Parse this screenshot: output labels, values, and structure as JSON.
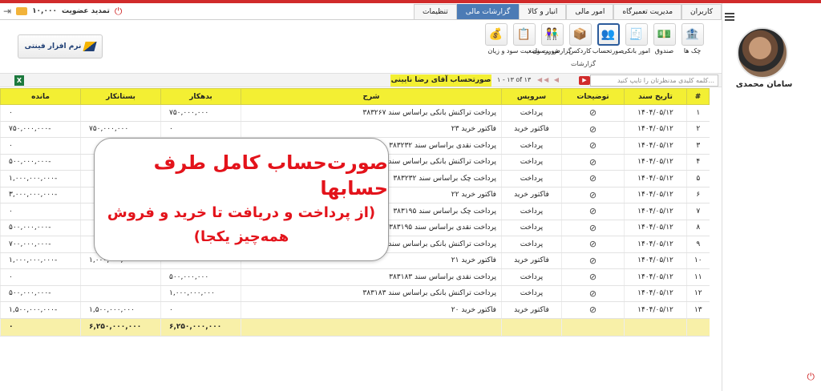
{
  "header": {
    "balance": "۱۰,۰۰۰",
    "renew_label": "تمدید عضویت"
  },
  "tabs": [
    {
      "label": "کاربران",
      "active": false
    },
    {
      "label": "مدیریت تعمیرگاه",
      "active": false
    },
    {
      "label": "امور مالی",
      "active": false
    },
    {
      "label": "انبار و کالا",
      "active": false
    },
    {
      "label": "گزارشات مالی",
      "active": true
    },
    {
      "label": "تنظیمات",
      "active": false
    }
  ],
  "logo_text": "نرم افزار فینتی",
  "tools": [
    {
      "label": "چک ها",
      "icon": "cheques-icon",
      "glyph": "🏦",
      "active": false
    },
    {
      "label": "صندوق",
      "icon": "cashbox-icon",
      "glyph": "💵",
      "active": false
    },
    {
      "label": "امور بانکی",
      "icon": "bank-affairs-icon",
      "glyph": "🧾",
      "active": false
    },
    {
      "label": "صورتحساب",
      "icon": "statement-icon",
      "glyph": "👥",
      "active": true
    },
    {
      "label": "کاردکس",
      "icon": "cardex-icon",
      "glyph": "📦",
      "active": false
    },
    {
      "label": "گزارش پرسنل",
      "icon": "personnel-report-icon",
      "glyph": "👫",
      "active": false
    },
    {
      "label": "صورت وضعیت سود و زیان",
      "icon": "profit-loss-icon",
      "glyph": "📋",
      "active": false
    },
    {
      "label": "",
      "icon": "statement-report-icon",
      "glyph": "💰",
      "active": false
    }
  ],
  "tools_group_label": "گزارشات",
  "filter": {
    "search_placeholder": "کلمه کلیدی مدنظرتان را تایپ کنید...",
    "page_info": "۱ - ۱۳ of ۱۳",
    "account_label": "صورتحساب آقای رضا نایینی"
  },
  "table": {
    "headers": [
      "#",
      "تاریخ سند",
      "توضیحات",
      "سرویس",
      "شرح",
      "بدهکار",
      "بستانکار",
      "مانده"
    ],
    "rows": [
      {
        "n": "۱",
        "date": "۱۴۰۴/۰۵/۱۲",
        "service": "پرداخت",
        "desc": "پرداخت تراکنش بانکی براساس سند ۳۸۳۲۶۷",
        "debit": "۷۵۰,۰۰۰,۰۰۰",
        "credit": "",
        "balance": "۰"
      },
      {
        "n": "۲",
        "date": "۱۴۰۴/۰۵/۱۲",
        "service": "فاکتور خرید",
        "desc": "فاکتور خرید ۲۳",
        "debit": "۰",
        "credit": "۷۵۰,۰۰۰,۰۰۰",
        "balance": "-۷۵۰,۰۰۰,۰۰۰"
      },
      {
        "n": "۳",
        "date": "۱۴۰۴/۰۵/۱۲",
        "service": "پرداخت",
        "desc": "پرداخت نقدی براساس سند ۳۸۳۲۳۲",
        "debit": "",
        "credit": "",
        "balance": "۰"
      },
      {
        "n": "۴",
        "date": "۱۴۰۴/۰۵/۱۲",
        "service": "پرداخت",
        "desc": "پرداخت تراکنش بانکی براساس سند ۳۸۳۲۳۲",
        "debit": "",
        "credit": "",
        "balance": "-۵۰۰,۰۰۰,۰۰۰"
      },
      {
        "n": "۵",
        "date": "۱۴۰۴/۰۵/۱۲",
        "service": "پرداخت",
        "desc": "پرداخت چک براساس سند ۳۸۳۲۳۲",
        "debit": "",
        "credit": "",
        "balance": "-۱,۰۰۰,۰۰۰,۰۰۰"
      },
      {
        "n": "۶",
        "date": "۱۴۰۴/۰۵/۱۲",
        "service": "فاکتور خرید",
        "desc": "فاکتور خرید ۲۲",
        "debit": "",
        "credit": "",
        "balance": "-۳,۰۰۰,۰۰۰,۰۰۰"
      },
      {
        "n": "۷",
        "date": "۱۴۰۴/۰۵/۱۲",
        "service": "پرداخت",
        "desc": "پرداخت چک براساس سند ۳۸۳۱۹۵",
        "debit": "",
        "credit": "",
        "balance": "۰"
      },
      {
        "n": "۸",
        "date": "۱۴۰۴/۰۵/۱۲",
        "service": "پرداخت",
        "desc": "پرداخت نقدی براساس سند ۳۸۳۱۹۵",
        "debit": "",
        "credit": "",
        "balance": "-۵۰۰,۰۰۰,۰۰۰"
      },
      {
        "n": "۹",
        "date": "۱۴۰۴/۰۵/۱۲",
        "service": "پرداخت",
        "desc": "پرداخت تراکنش بانکی براساس سند ۳۸۳۱۹۵",
        "debit": "",
        "credit": "",
        "balance": "-۷۰۰,۰۰۰,۰۰۰"
      },
      {
        "n": "۱۰",
        "date": "۱۴۰۴/۰۵/۱۲",
        "service": "فاکتور خرید",
        "desc": "فاکتور خرید ۲۱",
        "debit": "۰",
        "credit": "۱,۰۰۰,۰۰۰,۰۰۰",
        "balance": "-۱,۰۰۰,۰۰۰,۰۰۰"
      },
      {
        "n": "۱۱",
        "date": "۱۴۰۴/۰۵/۱۲",
        "service": "پرداخت",
        "desc": "پرداخت نقدی براساس سند ۳۸۳۱۸۳",
        "debit": "۵۰۰,۰۰۰,۰۰۰",
        "credit": "",
        "balance": "۰"
      },
      {
        "n": "۱۲",
        "date": "۱۴۰۴/۰۵/۱۲",
        "service": "پرداخت",
        "desc": "پرداخت تراکنش بانکی براساس سند ۳۸۳۱۸۳",
        "debit": "۱,۰۰۰,۰۰۰,۰۰۰",
        "credit": "",
        "balance": "-۵۰۰,۰۰۰,۰۰۰"
      },
      {
        "n": "۱۳",
        "date": "۱۴۰۴/۰۵/۱۲",
        "service": "فاکتور خرید",
        "desc": "فاکتور خرید ۲۰",
        "debit": "۰",
        "credit": "۱,۵۰۰,۰۰۰,۰۰۰",
        "balance": "-۱,۵۰۰,۰۰۰,۰۰۰"
      }
    ],
    "totals": {
      "debit": "۶,۲۵۰,۰۰۰,۰۰۰",
      "credit": "۶,۲۵۰,۰۰۰,۰۰۰",
      "balance": "۰"
    }
  },
  "callout": {
    "line1": "صورت‌حساب کامل طرف حسابها",
    "line2": "(از پرداخت و دریافت تا خرید و فروش",
    "line3": "همه‌چیز یکجا)"
  },
  "profile": {
    "name": "سامان محمدی"
  },
  "colors": {
    "accent": "#4c7bb5",
    "header_yellow": "#f3ef33",
    "total_row": "#f8f0a8",
    "alert_red": "#e3131b"
  }
}
